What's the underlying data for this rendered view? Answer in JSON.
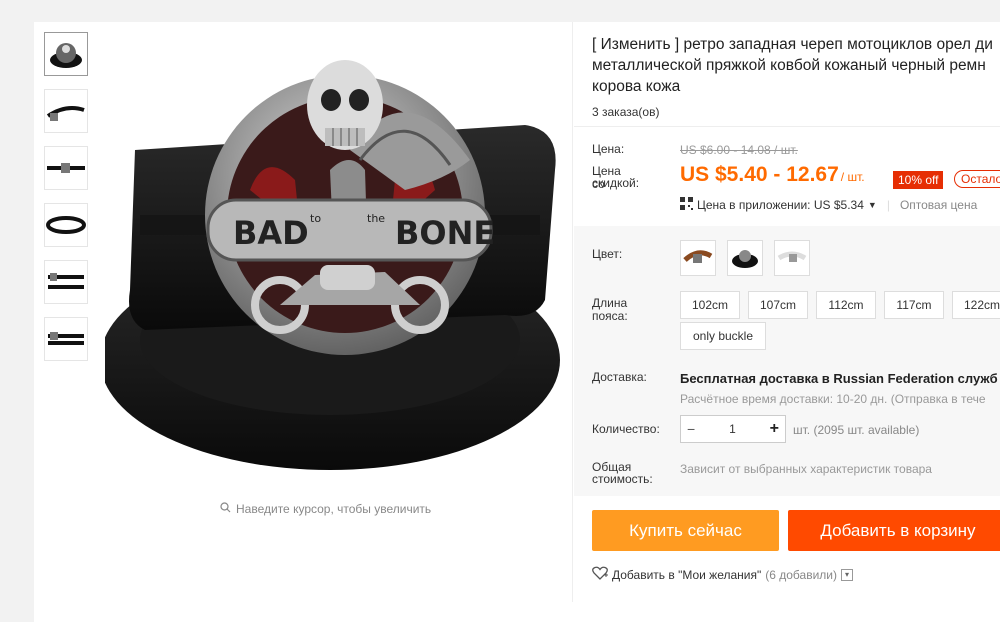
{
  "product": {
    "title_line1": "[ Изменить ] ретро западная череп мотоциклов орел ди",
    "title_line2": "металлической пряжкой ковбой кожаный черный ремн",
    "title_line3": "корова кожа",
    "orders": "3 заказа(ов)"
  },
  "gallery": {
    "zoom_hint": "Наведите курсор, чтобы увеличить",
    "buckle_text_left": "BAD",
    "buckle_text_mid_left": "to",
    "buckle_text_mid_right": "the",
    "buckle_text_right": "BONE"
  },
  "pricing": {
    "price_label": "Цена:",
    "old_price": "US $6.00 - 14.08 / шт.",
    "discount_label_line1": "Цена со",
    "discount_label_line2": "скидкой:",
    "price": "US $5.40 - 12.67",
    "unit": "/ шт.",
    "discount_badge": "10% off",
    "remaining": "Остало",
    "app_price": "Цена в приложении: US $5.34",
    "wholesale": "Оптовая цена"
  },
  "options": {
    "color_label": "Цвет:",
    "length_label": "Длина пояса:",
    "sizes": [
      "102cm",
      "107cm",
      "112cm",
      "117cm",
      "122cm",
      "only buckle"
    ]
  },
  "delivery": {
    "label": "Доставка:",
    "value": "Бесплатная доставка в Russian Federation служб",
    "estimate": "Расчётное время доставки: 10-20 дн. (Отправка в тече"
  },
  "quantity": {
    "label": "Количество:",
    "value": "1",
    "minus": "−",
    "plus": "+",
    "available": "шт. (2095 шт. available)"
  },
  "total": {
    "label_line1": "Общая",
    "label_line2": "стоимость:",
    "value": "Зависит от выбранных характеристик товара"
  },
  "actions": {
    "buy_now": "Купить сейчас",
    "add_to_cart": "Добавить в корзину",
    "wishlist": "Добавить в \"Мои желания\"",
    "wishlist_count": "(6 добавили)"
  },
  "colors": {
    "accent": "#ff6a00",
    "buy": "#ff9b21",
    "cart": "#ff4a00",
    "badge": "#e62e04"
  }
}
